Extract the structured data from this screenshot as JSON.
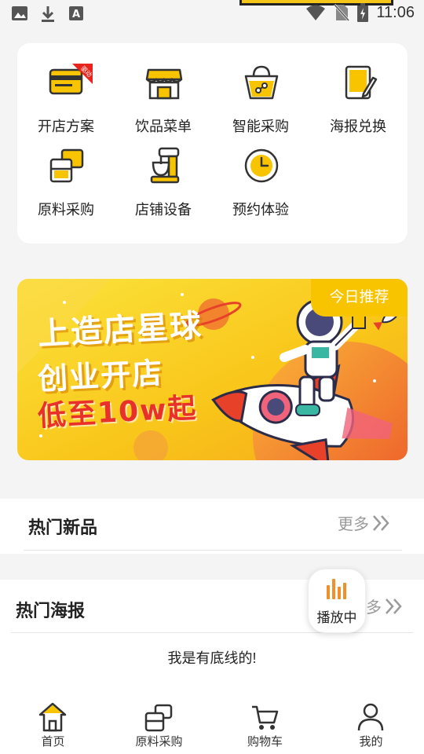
{
  "status_bar": {
    "time": "11:06",
    "icons": [
      "image-icon",
      "download-icon",
      "font-icon",
      "wifi-icon",
      "no-sim-icon",
      "battery-charging-icon"
    ]
  },
  "menu": {
    "items": [
      {
        "label": "开店方案",
        "icon": "store-plan-icon",
        "badge": "驱动"
      },
      {
        "label": "饮品菜单",
        "icon": "storefront-icon"
      },
      {
        "label": "智能采购",
        "icon": "shopping-bag-icon"
      },
      {
        "label": "海报兑换",
        "icon": "poster-edit-icon"
      },
      {
        "label": "原料采购",
        "icon": "materials-icon"
      },
      {
        "label": "店铺设备",
        "icon": "mixer-icon"
      },
      {
        "label": "预约体验",
        "icon": "clock-icon"
      }
    ]
  },
  "banner": {
    "badge": "今日推荐",
    "line1": "上造店星球",
    "line2": "创业开店",
    "line3": "低至10w起"
  },
  "section_new": {
    "title": "热门新品",
    "more": "更多"
  },
  "section_poster": {
    "title": "热门海报",
    "more": "更多",
    "footer": "我是有底线的!"
  },
  "player": {
    "label": "播放中"
  },
  "tabbar": {
    "items": [
      {
        "label": "首页",
        "icon": "home-icon"
      },
      {
        "label": "原料采购",
        "icon": "materials-icon"
      },
      {
        "label": "购物车",
        "icon": "cart-icon"
      },
      {
        "label": "我的",
        "icon": "profile-icon"
      }
    ]
  },
  "colors": {
    "accent": "#f8c400",
    "badge_red": "#e8241c",
    "orange": "#f0902a"
  }
}
